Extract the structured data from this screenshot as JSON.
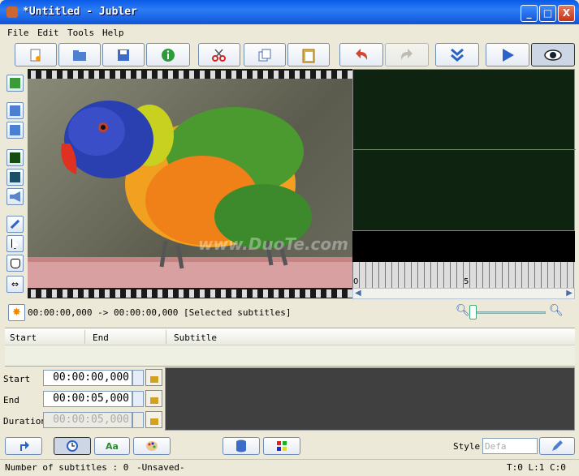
{
  "window": {
    "title": "*Untitled - Jubler",
    "minimize": "_",
    "maximize": "□",
    "close": "X"
  },
  "menu": [
    "File",
    "Edit",
    "Tools",
    "Help"
  ],
  "toolbar_icons": [
    "new-file-icon",
    "open-folder-icon",
    "save-icon",
    "info-icon",
    "cut-icon",
    "copy-icon",
    "paste-icon",
    "undo-icon",
    "redo-icon",
    "jump-down-icon",
    "play-icon",
    "preview-eye-icon"
  ],
  "side_tools": [
    "subtitle-list-icon",
    "new-image-icon",
    "image-icon",
    "waveform-icon",
    "spectrum-icon",
    "audio-icon",
    "magic-wand-icon",
    "select-pointer-icon",
    "hand-move-icon",
    "resize-icon"
  ],
  "watermark": "www.DuoTe.com",
  "ruler": {
    "label0": "0",
    "label5": "5"
  },
  "timeline": {
    "text": "00:00:00,000 -> 00:00:00,000 [Selected subtitles]"
  },
  "table": {
    "headers": [
      "Start",
      "End",
      "Subtitle"
    ]
  },
  "editor": {
    "start_label": "Start",
    "start_value": "00:00:00,000",
    "end_label": "End",
    "end_value": "00:00:05,000",
    "duration_label": "Duration",
    "duration_value": "00:00:05,000"
  },
  "bottom": {
    "style_label": "Style",
    "style_value": "Defa",
    "aa_label": "Aa"
  },
  "status": {
    "count": "Number of subtitles : 0",
    "saved": "-Unsaved-",
    "pos": "T:0 L:1 C:0"
  },
  "colors": {
    "title_bar": "#0a5ae8",
    "waveform_bg": "#0f2410",
    "accent_blue": "#2a62c9"
  }
}
